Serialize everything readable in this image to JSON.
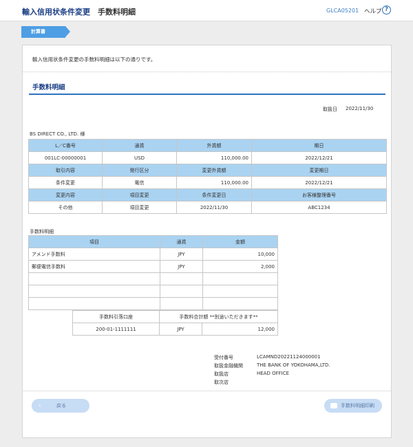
{
  "header": {
    "title": "輸入信用状条件変更",
    "subtitle": "手数料明細",
    "screen_code": "GLCA05201",
    "help_label": "ヘルプ",
    "help_icon_glyph": "?"
  },
  "step": {
    "label": "計算書"
  },
  "intro": "輸入信用状条件変更の手数料明細は以下の通りです。",
  "section_title": "手数料明細",
  "date": {
    "label": "取扱日",
    "value": "2022/11/30"
  },
  "customer": "BS DIRECT CO., LTD.  様",
  "main_table": {
    "row1_headers": [
      "L／C番号",
      "通貨",
      "外貨額",
      "期日"
    ],
    "row1_values": [
      "001LC-00000001",
      "USD",
      "110,000.00",
      "2022/12/21"
    ],
    "row2_headers": [
      "取引内容",
      "発行区分",
      "変更外貨額",
      "変更期日"
    ],
    "row2_values": [
      "条件変更",
      "電信",
      "110,000.00",
      "2022/12/21"
    ],
    "row3_headers": [
      "変更内容",
      "項目変更",
      "条件変更日",
      "お客様整理番号"
    ],
    "row3_values": [
      "その他",
      "項目変更",
      "2022/11/30",
      "ABC1234"
    ]
  },
  "fee": {
    "title": "手数料明細",
    "headers": [
      "項目",
      "通貨",
      "金額"
    ],
    "rows": [
      {
        "item": "アメンド手数料",
        "currency": "JPY",
        "amount": "10,000"
      },
      {
        "item": "郵便電信手数料",
        "currency": "JPY",
        "amount": "2,000"
      }
    ],
    "summary_headers": [
      "手数料引落口座",
      "手数料合計額 **別途いただきます**"
    ],
    "summary_account": "200-01-1111111",
    "summary_currency": "JPY",
    "summary_amount": "12,000"
  },
  "reference": {
    "receipt_label": "受付番号",
    "receipt_value": "LCAMND20221124000001",
    "bank_label": "取扱金融機関",
    "bank_value": "THE BANK OF YOKOHAMA,LTD.",
    "branch_label": "取扱店",
    "branch_value": "HEAD OFFICE",
    "agent_label": "取次店",
    "agent_value": ""
  },
  "buttons": {
    "back": "戻る",
    "print": "手数料明細印刷"
  }
}
